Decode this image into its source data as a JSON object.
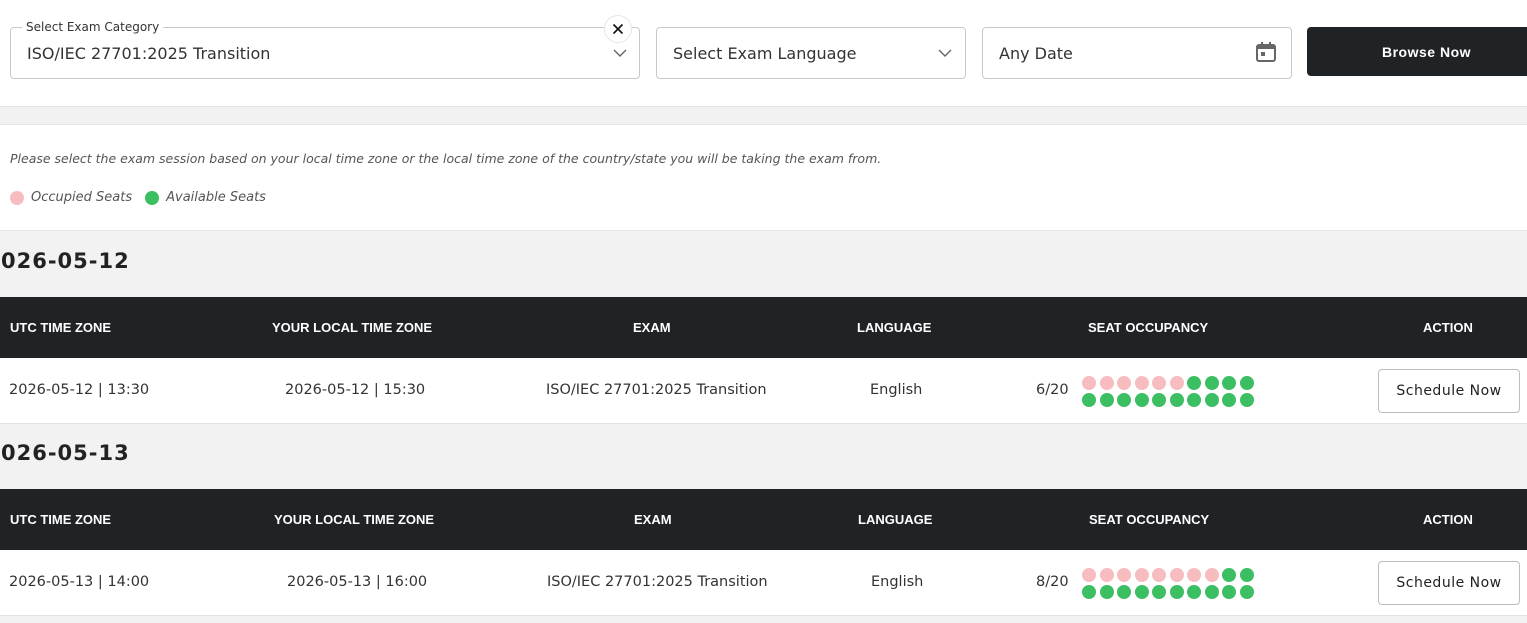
{
  "filters": {
    "category": {
      "legend": "Select Exam Category",
      "value": "ISO/IEC 27701:2025 Transition"
    },
    "language": {
      "placeholder": "Select Exam Language"
    },
    "date": {
      "placeholder": "Any Date"
    },
    "browse_label": "Browse Now"
  },
  "info": {
    "note": "Please select the exam session based on your local time zone or the local time zone of the country/state you will be taking the exam from.",
    "legend_occupied": "Occupied Seats",
    "legend_available": "Available Seats"
  },
  "colors": {
    "occupied": "#f7bcbf",
    "available": "#3cbf62",
    "header_bg": "#202326"
  },
  "table_headers": [
    "UTC TIME ZONE",
    "YOUR LOCAL TIME ZONE",
    "EXAM",
    "LANGUAGE",
    "SEAT OCCUPANCY",
    "ACTION"
  ],
  "sessions": [
    {
      "date_label": "026-05-12",
      "utc": "2026-05-12 | 13:30",
      "local": "2026-05-12 | 15:30",
      "exam": "ISO/IEC 27701:2025 Transition",
      "language": "English",
      "occupancy_text": "6/20",
      "occupied": 6,
      "total": 20,
      "action": "Schedule Now"
    },
    {
      "date_label": "026-05-13",
      "utc": "2026-05-13 | 14:00",
      "local": "2026-05-13 | 16:00",
      "exam": "ISO/IEC 27701:2025 Transition",
      "language": "English",
      "occupancy_text": "8/20",
      "occupied": 8,
      "total": 20,
      "action": "Schedule Now"
    }
  ]
}
